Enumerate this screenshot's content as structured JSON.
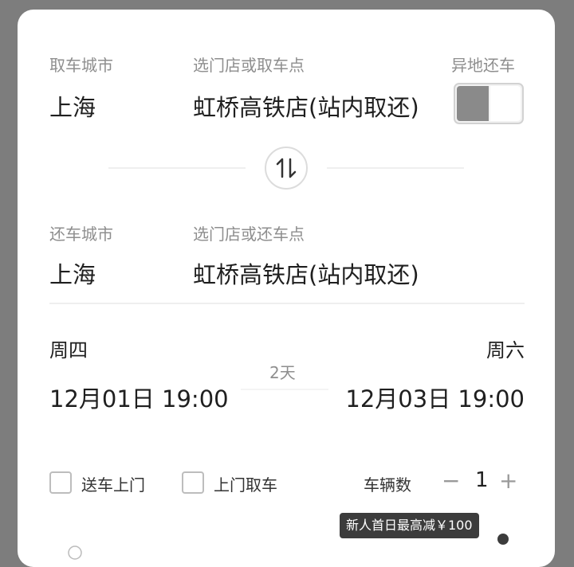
{
  "pickup": {
    "city_label": "取车城市",
    "city": "上海",
    "store_label": "选门店或取车点",
    "store": "虹桥高铁店(站内取还)"
  },
  "one_way": {
    "label": "异地还车",
    "enabled": false
  },
  "swap": {
    "icon": "swap-vertical-icon"
  },
  "dropoff": {
    "city_label": "还车城市",
    "city": "上海",
    "store_label": "选门店或还车点",
    "store": "虹桥高铁店(站内取还)"
  },
  "dates": {
    "start_weekday": "周四",
    "start": "12月01日 19:00",
    "duration": "2天",
    "end_weekday": "周六",
    "end": "12月03日 19:00"
  },
  "options": {
    "delivery_label": "送车上门",
    "pickup_service_label": "上门取车",
    "vehicle_count_label": "车辆数",
    "minus": "−",
    "vehicle_count": "1",
    "plus": "+"
  },
  "promo": {
    "text": "新人首日最高减￥100"
  },
  "colors": {
    "background_overlay": "#7d7d7d",
    "card": "#ffffff",
    "text_primary": "#1f1f1f",
    "text_secondary": "#8e8e8e",
    "toggle_fill": "#8a8a8a",
    "promo_bg": "#3c3c3c"
  }
}
